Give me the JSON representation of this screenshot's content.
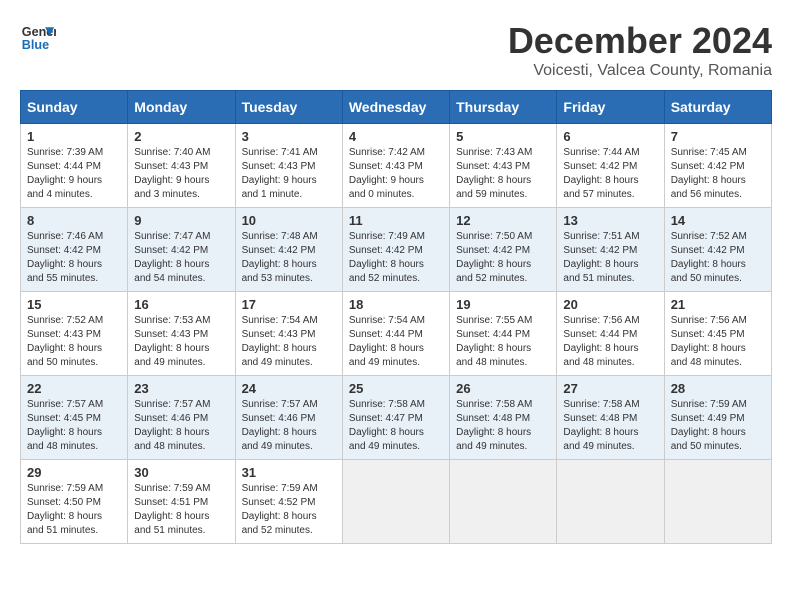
{
  "logo": {
    "line1": "General",
    "line2": "Blue"
  },
  "title": "December 2024",
  "location": "Voicesti, Valcea County, Romania",
  "weekdays": [
    "Sunday",
    "Monday",
    "Tuesday",
    "Wednesday",
    "Thursday",
    "Friday",
    "Saturday"
  ],
  "weeks": [
    [
      {
        "day": "1",
        "info": "Sunrise: 7:39 AM\nSunset: 4:44 PM\nDaylight: 9 hours\nand 4 minutes."
      },
      {
        "day": "2",
        "info": "Sunrise: 7:40 AM\nSunset: 4:43 PM\nDaylight: 9 hours\nand 3 minutes."
      },
      {
        "day": "3",
        "info": "Sunrise: 7:41 AM\nSunset: 4:43 PM\nDaylight: 9 hours\nand 1 minute."
      },
      {
        "day": "4",
        "info": "Sunrise: 7:42 AM\nSunset: 4:43 PM\nDaylight: 9 hours\nand 0 minutes."
      },
      {
        "day": "5",
        "info": "Sunrise: 7:43 AM\nSunset: 4:43 PM\nDaylight: 8 hours\nand 59 minutes."
      },
      {
        "day": "6",
        "info": "Sunrise: 7:44 AM\nSunset: 4:42 PM\nDaylight: 8 hours\nand 57 minutes."
      },
      {
        "day": "7",
        "info": "Sunrise: 7:45 AM\nSunset: 4:42 PM\nDaylight: 8 hours\nand 56 minutes."
      }
    ],
    [
      {
        "day": "8",
        "info": "Sunrise: 7:46 AM\nSunset: 4:42 PM\nDaylight: 8 hours\nand 55 minutes."
      },
      {
        "day": "9",
        "info": "Sunrise: 7:47 AM\nSunset: 4:42 PM\nDaylight: 8 hours\nand 54 minutes."
      },
      {
        "day": "10",
        "info": "Sunrise: 7:48 AM\nSunset: 4:42 PM\nDaylight: 8 hours\nand 53 minutes."
      },
      {
        "day": "11",
        "info": "Sunrise: 7:49 AM\nSunset: 4:42 PM\nDaylight: 8 hours\nand 52 minutes."
      },
      {
        "day": "12",
        "info": "Sunrise: 7:50 AM\nSunset: 4:42 PM\nDaylight: 8 hours\nand 52 minutes."
      },
      {
        "day": "13",
        "info": "Sunrise: 7:51 AM\nSunset: 4:42 PM\nDaylight: 8 hours\nand 51 minutes."
      },
      {
        "day": "14",
        "info": "Sunrise: 7:52 AM\nSunset: 4:42 PM\nDaylight: 8 hours\nand 50 minutes."
      }
    ],
    [
      {
        "day": "15",
        "info": "Sunrise: 7:52 AM\nSunset: 4:43 PM\nDaylight: 8 hours\nand 50 minutes."
      },
      {
        "day": "16",
        "info": "Sunrise: 7:53 AM\nSunset: 4:43 PM\nDaylight: 8 hours\nand 49 minutes."
      },
      {
        "day": "17",
        "info": "Sunrise: 7:54 AM\nSunset: 4:43 PM\nDaylight: 8 hours\nand 49 minutes."
      },
      {
        "day": "18",
        "info": "Sunrise: 7:54 AM\nSunset: 4:44 PM\nDaylight: 8 hours\nand 49 minutes."
      },
      {
        "day": "19",
        "info": "Sunrise: 7:55 AM\nSunset: 4:44 PM\nDaylight: 8 hours\nand 48 minutes."
      },
      {
        "day": "20",
        "info": "Sunrise: 7:56 AM\nSunset: 4:44 PM\nDaylight: 8 hours\nand 48 minutes."
      },
      {
        "day": "21",
        "info": "Sunrise: 7:56 AM\nSunset: 4:45 PM\nDaylight: 8 hours\nand 48 minutes."
      }
    ],
    [
      {
        "day": "22",
        "info": "Sunrise: 7:57 AM\nSunset: 4:45 PM\nDaylight: 8 hours\nand 48 minutes."
      },
      {
        "day": "23",
        "info": "Sunrise: 7:57 AM\nSunset: 4:46 PM\nDaylight: 8 hours\nand 48 minutes."
      },
      {
        "day": "24",
        "info": "Sunrise: 7:57 AM\nSunset: 4:46 PM\nDaylight: 8 hours\nand 49 minutes."
      },
      {
        "day": "25",
        "info": "Sunrise: 7:58 AM\nSunset: 4:47 PM\nDaylight: 8 hours\nand 49 minutes."
      },
      {
        "day": "26",
        "info": "Sunrise: 7:58 AM\nSunset: 4:48 PM\nDaylight: 8 hours\nand 49 minutes."
      },
      {
        "day": "27",
        "info": "Sunrise: 7:58 AM\nSunset: 4:48 PM\nDaylight: 8 hours\nand 49 minutes."
      },
      {
        "day": "28",
        "info": "Sunrise: 7:59 AM\nSunset: 4:49 PM\nDaylight: 8 hours\nand 50 minutes."
      }
    ],
    [
      {
        "day": "29",
        "info": "Sunrise: 7:59 AM\nSunset: 4:50 PM\nDaylight: 8 hours\nand 51 minutes."
      },
      {
        "day": "30",
        "info": "Sunrise: 7:59 AM\nSunset: 4:51 PM\nDaylight: 8 hours\nand 51 minutes."
      },
      {
        "day": "31",
        "info": "Sunrise: 7:59 AM\nSunset: 4:52 PM\nDaylight: 8 hours\nand 52 minutes."
      },
      {
        "day": "",
        "info": ""
      },
      {
        "day": "",
        "info": ""
      },
      {
        "day": "",
        "info": ""
      },
      {
        "day": "",
        "info": ""
      }
    ]
  ]
}
